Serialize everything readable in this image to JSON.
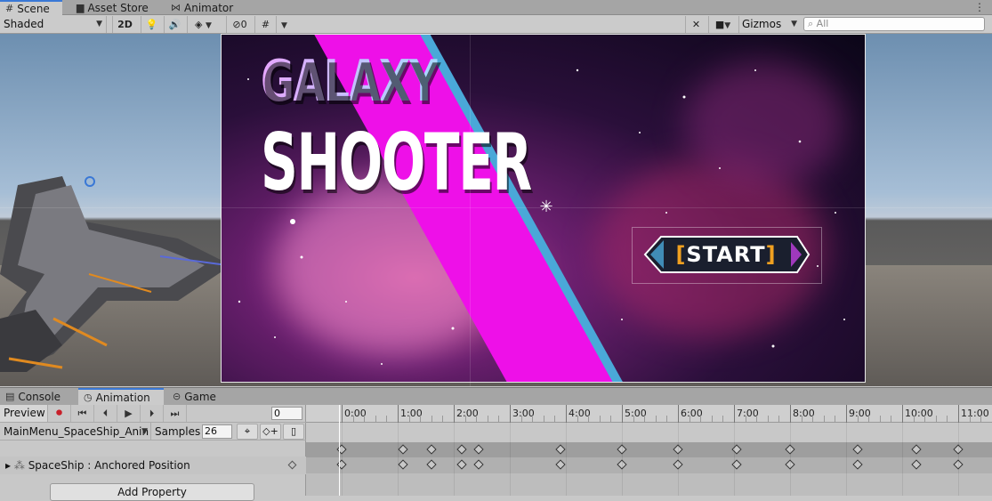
{
  "top_tabs": [
    {
      "label": "Scene",
      "icon": "hash-grid-icon",
      "active": true
    },
    {
      "label": "Asset Store",
      "icon": "bag-icon",
      "active": false
    },
    {
      "label": "Animator",
      "icon": "animator-icon",
      "active": false
    }
  ],
  "toolbar": {
    "shading_mode": "Shaded",
    "mode_2d": "2D",
    "hidden_count": "0",
    "gizmos_label": "Gizmos",
    "search_placeholder": "All"
  },
  "scene_content": {
    "title_line1": "GALAXY",
    "title_line2": "SHOOTER",
    "start_left_bracket": "[",
    "start_label": "START",
    "start_right_bracket": "]"
  },
  "bottom_tabs": [
    {
      "label": "Console",
      "icon": "console-icon",
      "active": false
    },
    {
      "label": "Animation",
      "icon": "clock-icon",
      "active": true
    },
    {
      "label": "Game",
      "icon": "gamepad-icon",
      "active": false
    }
  ],
  "animation": {
    "preview_label": "Preview",
    "frame": "0",
    "clip_name": "MainMenu_SpaceShip_Anin",
    "samples_label": "Samples",
    "samples": "26",
    "property_name": "SpaceShip : Anchored Position",
    "add_property_label": "Add Property",
    "ruler_labels": [
      "0:00",
      "1:00",
      "2:00",
      "3:00",
      "4:00",
      "5:00",
      "6:00",
      "7:00",
      "8:00",
      "9:00",
      "10:00",
      "11:00"
    ],
    "keyframe_times": [
      0,
      1.1,
      1.6,
      2.15,
      2.45,
      3.9,
      5.0,
      6.0,
      7.05,
      8.0,
      9.2,
      10.25,
      11.0
    ]
  },
  "colors": {
    "accent": "#3a78d6",
    "stripe_magenta": "#ee10e8",
    "stripe_blue": "#4aa8d8",
    "start_bracket": "#f0a020",
    "record": "#c8202a"
  }
}
